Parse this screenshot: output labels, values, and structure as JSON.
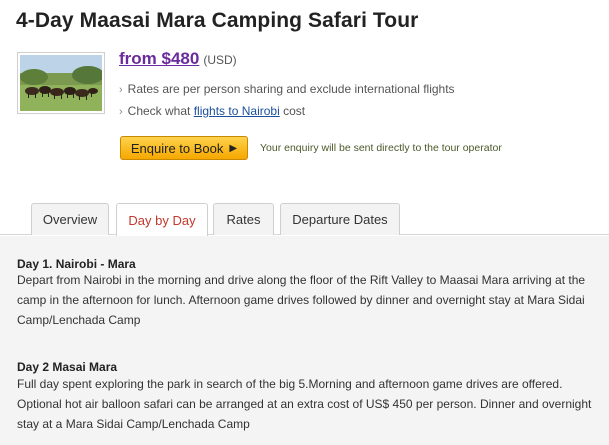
{
  "tour": {
    "title": "4-Day Maasai Mara Camping Safari Tour"
  },
  "pricing": {
    "price": "from $480",
    "currency": "(USD)"
  },
  "bullets": {
    "rates_note": "Rates are per person sharing and exclude international flights",
    "flights_prefix": "Check what ",
    "flights_link": "flights to Nairobi",
    "flights_suffix": " cost"
  },
  "enquiry": {
    "button_label": "Enquire to Book",
    "note": "Your enquiry will be sent directly to the tour operator"
  },
  "tabs": [
    {
      "label": "Overview",
      "active": false
    },
    {
      "label": "Day by Day",
      "active": true
    },
    {
      "label": "Rates",
      "active": false
    },
    {
      "label": "Departure Dates",
      "active": false
    }
  ],
  "itinerary": [
    {
      "title": "Day 1. Nairobi - Mara",
      "text": "Depart from Nairobi in the morning and drive along the floor of the Rift Valley to Maasai Mara arriving at the camp in the afternoon for lunch. Afternoon game drives followed by dinner and overnight stay at Mara Sidai Camp/Lenchada Camp"
    },
    {
      "title": "Day 2 Masai Mara",
      "text": "Full day spent exploring the park in search of the big 5.Morning and afternoon game drives are offered. Optional hot air balloon safari can be arranged at an extra cost of US$ 450 per person. Dinner and overnight stay at a Mara Sidai Camp/Lenchada Camp"
    }
  ],
  "colors": {
    "price_link": "#6a2b9c",
    "active_tab_text": "#c0392b",
    "button_gradient_top": "#ffd24d",
    "button_gradient_bottom": "#f5a800"
  }
}
